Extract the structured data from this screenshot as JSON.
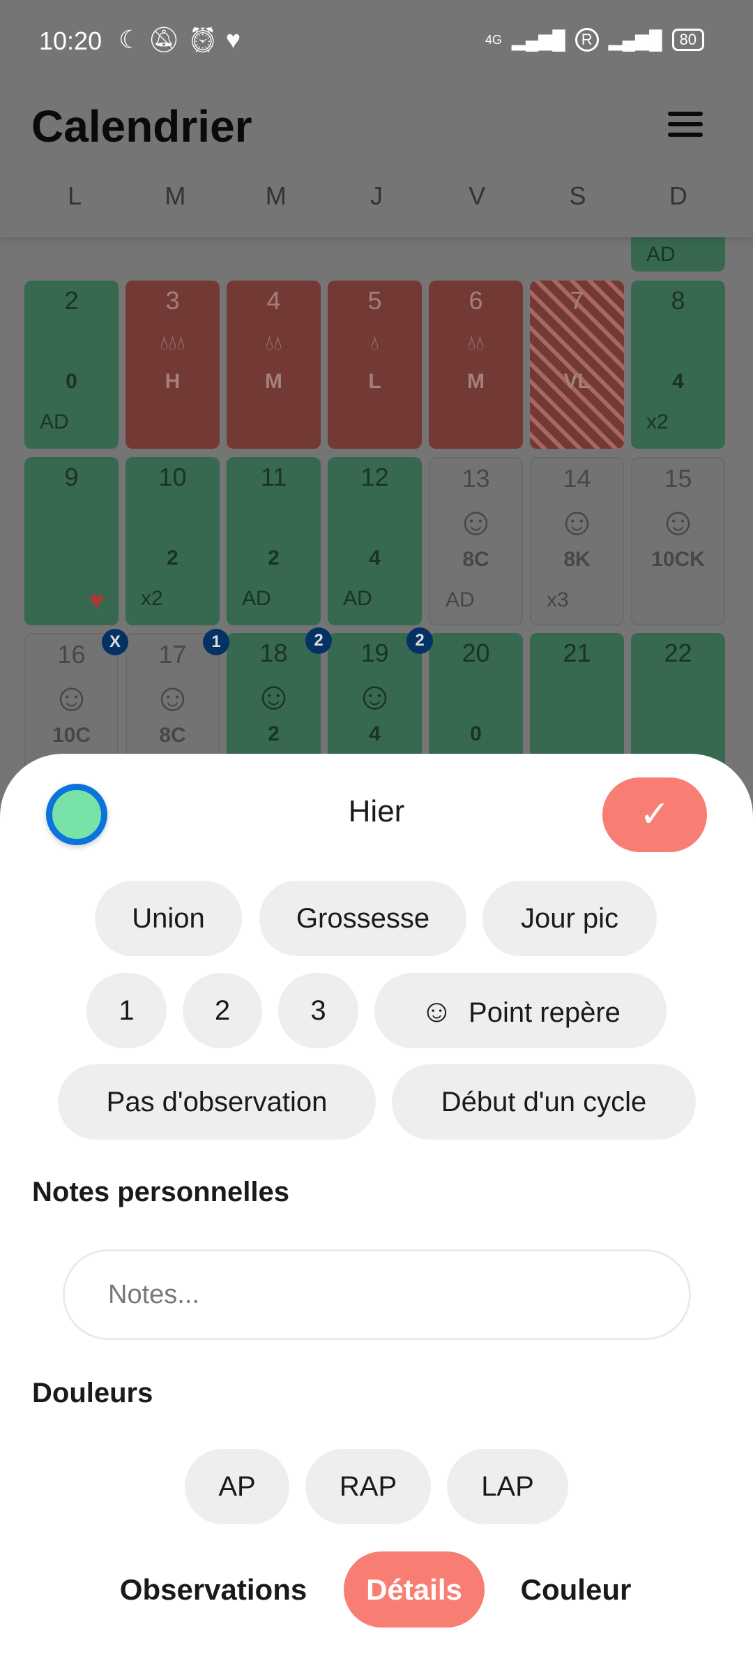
{
  "status_bar": {
    "time": "10:20",
    "left_icons": [
      "moon-icon",
      "vibrate-off-icon",
      "alarm-icon",
      "heart-icon"
    ],
    "network": "4G",
    "roaming": "R",
    "battery": "80"
  },
  "header": {
    "title": "Calendrier",
    "weekdays": [
      "L",
      "M",
      "M",
      "J",
      "V",
      "S",
      "D"
    ]
  },
  "colors": {
    "green": "#78e2ae",
    "red": "#f97e73",
    "accent": "#f87e74",
    "badge": "#0a6ed8"
  },
  "calendar": {
    "partial_top": {
      "bottom": "AD"
    },
    "rows": [
      [
        {
          "day": "2",
          "type": "green",
          "mid": "0",
          "bottom": "AD"
        },
        {
          "day": "3",
          "type": "red",
          "icon": "drops-3",
          "mid": "H"
        },
        {
          "day": "4",
          "type": "red",
          "icon": "drops-2",
          "mid": "M"
        },
        {
          "day": "5",
          "type": "red",
          "icon": "drops-1",
          "mid": "L"
        },
        {
          "day": "6",
          "type": "red",
          "icon": "drops-2",
          "mid": "M"
        },
        {
          "day": "7",
          "type": "hatched",
          "mid": "VL"
        },
        {
          "day": "8",
          "type": "green",
          "mid": "4",
          "bottom": "x2"
        }
      ],
      [
        {
          "day": "9",
          "type": "green",
          "heart": true
        },
        {
          "day": "10",
          "type": "green",
          "mid": "2",
          "bottom": "x2"
        },
        {
          "day": "11",
          "type": "green",
          "mid": "2",
          "bottom": "AD"
        },
        {
          "day": "12",
          "type": "green",
          "mid": "4",
          "bottom": "AD"
        },
        {
          "day": "13",
          "type": "grey",
          "icon": "baby",
          "mid": "8C",
          "bottom": "AD"
        },
        {
          "day": "14",
          "type": "grey",
          "icon": "baby",
          "mid": "8K",
          "bottom": "x3"
        },
        {
          "day": "15",
          "type": "grey",
          "icon": "baby",
          "mid": "10CK"
        }
      ],
      [
        {
          "day": "16",
          "type": "grey",
          "icon": "baby",
          "mid": "10C",
          "badge": "X"
        },
        {
          "day": "17",
          "type": "grey",
          "icon": "baby",
          "mid": "8C",
          "badge": "1"
        },
        {
          "day": "18",
          "type": "green",
          "icon": "baby",
          "mid": "2",
          "badge": "2"
        },
        {
          "day": "19",
          "type": "green",
          "icon": "baby",
          "mid": "4",
          "badge": "2"
        },
        {
          "day": "20",
          "type": "green",
          "mid": "0"
        },
        {
          "day": "21",
          "type": "green"
        },
        {
          "day": "22",
          "type": "green"
        }
      ]
    ]
  },
  "sheet": {
    "title": "Hier",
    "confirm_icon": "check-icon",
    "chips": {
      "union": "Union",
      "grossesse": "Grossesse",
      "jour_pic": "Jour pic",
      "one": "1",
      "two": "2",
      "three": "3",
      "point_repere": "Point repère",
      "pas_observation": "Pas d'observation",
      "debut_cycle": "Début d'un cycle"
    },
    "notes_heading": "Notes personnelles",
    "notes_placeholder": "Notes...",
    "notes_value": "",
    "pain_heading": "Douleurs",
    "pain": {
      "ap": "AP",
      "rap": "RAP",
      "lap": "LAP"
    },
    "tabs": {
      "observations": "Observations",
      "details": "Détails",
      "couleur": "Couleur",
      "active": "Détails"
    }
  }
}
